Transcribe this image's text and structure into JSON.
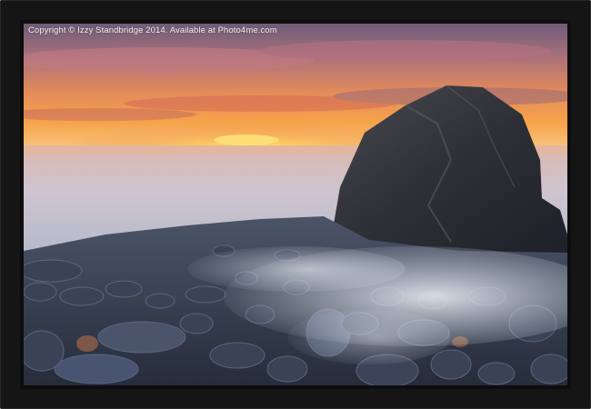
{
  "watermark": {
    "text": "Copyright © Izzy Standbridge 2014. Available at Photo4me.com"
  },
  "frame": {
    "color": "#151515"
  },
  "photo": {
    "subject": "sunset-over-sea-with-rock-and-pebbles",
    "palette": {
      "sky_top": "#6b5a74",
      "sky_glow": "#f6a24a",
      "sun": "#ffe07a",
      "sea": "#c9c2cf",
      "rock": "#2f3138",
      "pebbles": "#3d4658",
      "mist": "#e6ecf6"
    }
  }
}
